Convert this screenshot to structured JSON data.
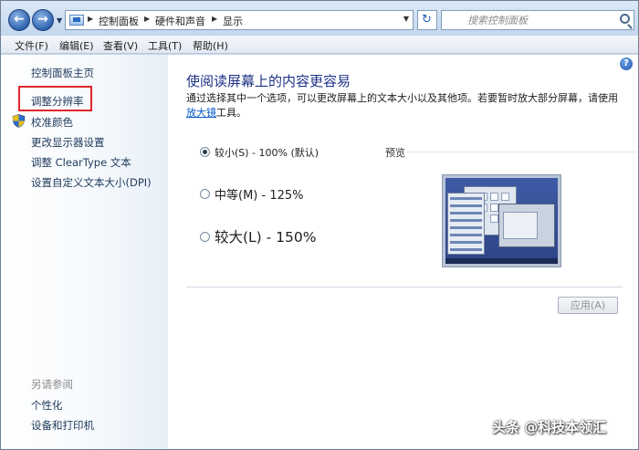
{
  "address_bar": {
    "breadcrumbs": [
      "控制面板",
      "硬件和声音",
      "显示"
    ],
    "search_placeholder": "搜索控制面板"
  },
  "menu": [
    "文件(F)",
    "编辑(E)",
    "查看(V)",
    "工具(T)",
    "帮助(H)"
  ],
  "sidebar": {
    "items": [
      "控制面板主页",
      "调整分辨率",
      "校准颜色",
      "更改显示器设置",
      "调整 ClearType 文本",
      "设置自定义文本大小(DPI)"
    ],
    "see_also_heading": "另请参阅",
    "see_also": [
      "个性化",
      "设备和打印机"
    ]
  },
  "main": {
    "title": "使阅读屏幕上的内容更容易",
    "description": "通过选择其中一个选项，可以更改屏幕上的文本大小以及其他项。若要暂时放大部分屏幕，请使用",
    "description_link": "放大镜",
    "description_tail": "工具。",
    "options": [
      {
        "label": "较小(S) - 100% (默认)",
        "checked": true
      },
      {
        "label": "中等(M) - 125%",
        "checked": false
      },
      {
        "label": "较大(L) - 150%",
        "checked": false
      }
    ],
    "preview_label": "预览",
    "apply_label": "应用(A)"
  },
  "help_label": "?",
  "watermark": "头条 @科技本领汇",
  "colors": {
    "title_blue": "#1e3287",
    "link_blue": "#0c5cc7",
    "highlight_red": "#e1262b"
  }
}
